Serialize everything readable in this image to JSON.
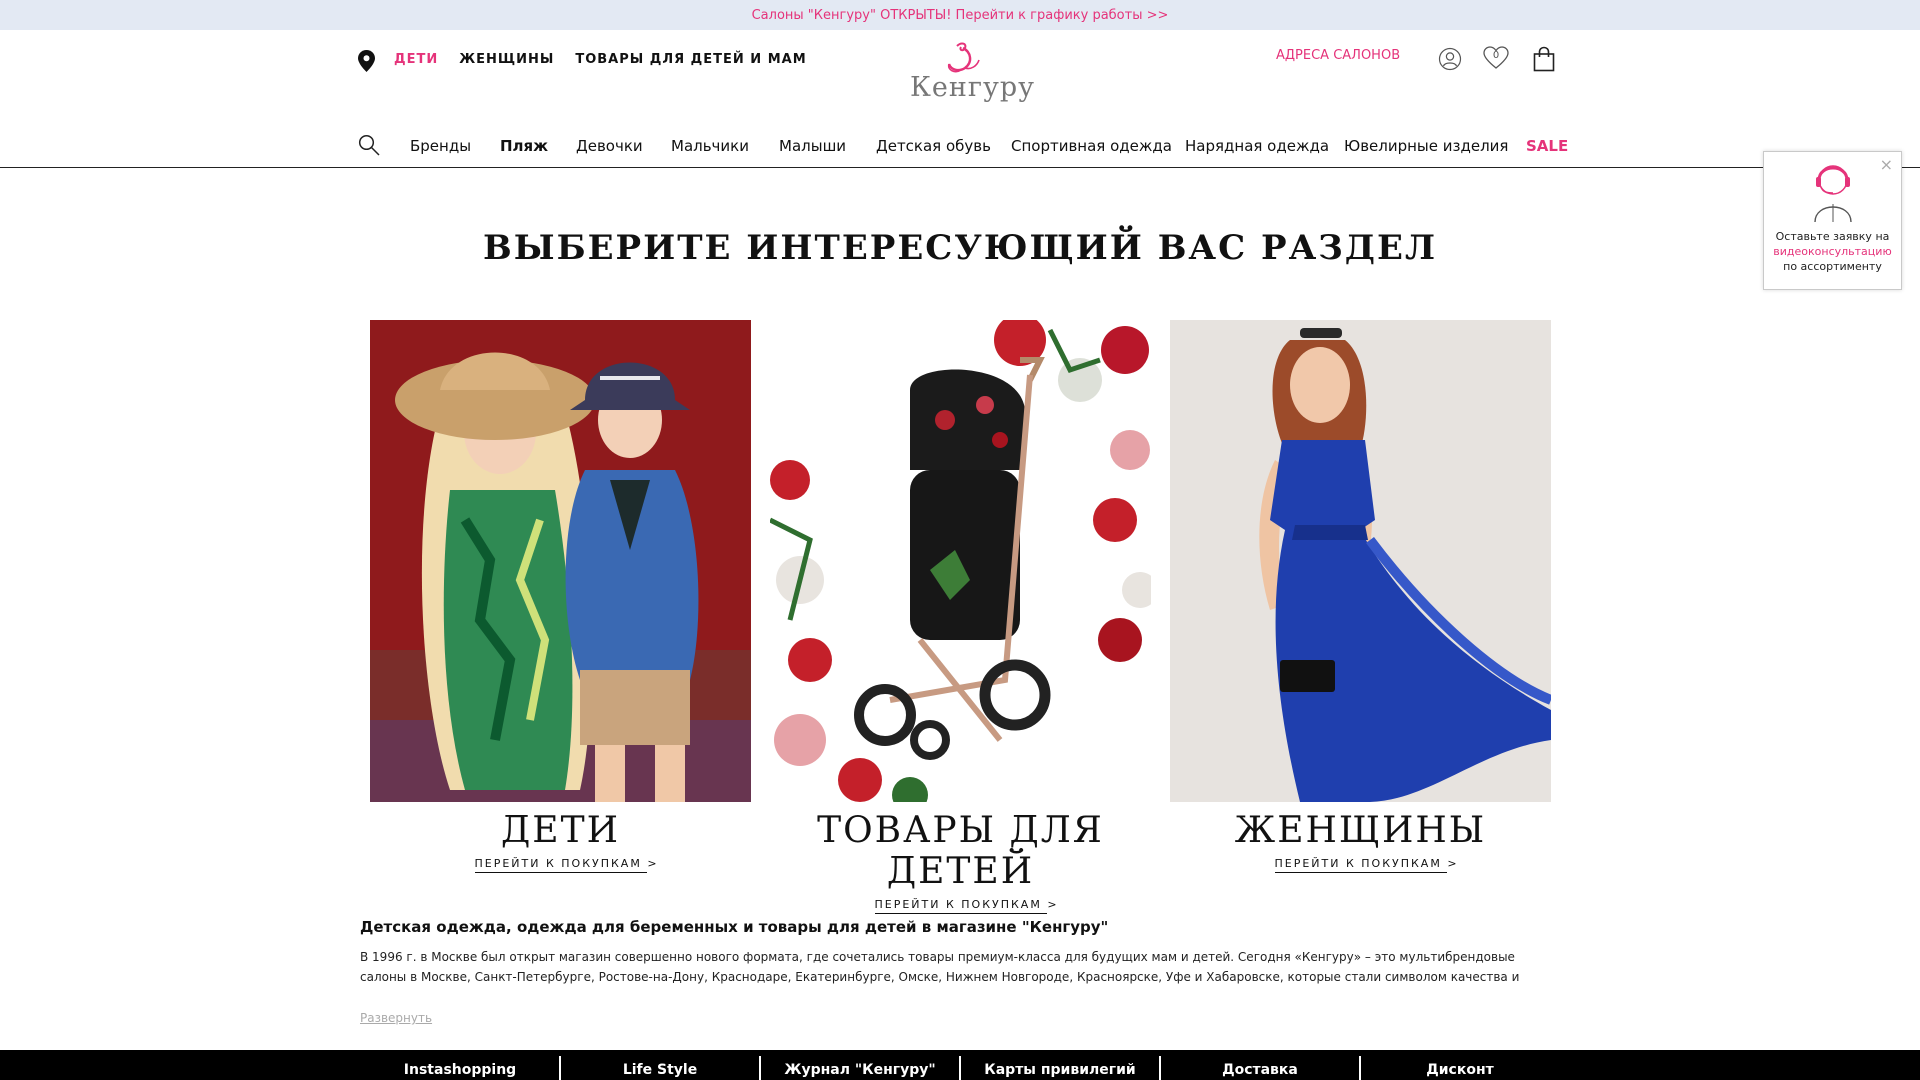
{
  "promo": {
    "text": "Салоны \"Кенгуру\" ОТКРЫТЫ! Перейти к графику работы >>"
  },
  "header": {
    "top_nav": [
      {
        "label": "ДЕТИ",
        "active": true
      },
      {
        "label": "ЖЕНЩИНЫ",
        "active": false
      },
      {
        "label": "ТОВАРЫ ДЛЯ ДЕТЕЙ И МАМ",
        "active": false
      }
    ],
    "logo_text": "Кенгуру",
    "addresses_label": "АДРЕСА САЛОНОВ",
    "favorites_count": "0",
    "icons": [
      "location-pin-icon",
      "user-icon",
      "heart-icon",
      "shopping-bag-icon",
      "search-icon"
    ]
  },
  "catalog_nav": [
    {
      "label": "Бренды",
      "style": "normal"
    },
    {
      "label": "Пляж",
      "style": "bold"
    },
    {
      "label": "Девочки",
      "style": "normal"
    },
    {
      "label": "Мальчики",
      "style": "normal"
    },
    {
      "label": "Малыши",
      "style": "normal"
    },
    {
      "label": "Детская обувь",
      "style": "normal"
    },
    {
      "label": "Спортивная одежда",
      "style": "normal"
    },
    {
      "label": "Нарядная одежда",
      "style": "normal"
    },
    {
      "label": "Ювелирные изделия",
      "style": "normal"
    },
    {
      "label": "SALE",
      "style": "sale"
    }
  ],
  "main": {
    "heading": "ВЫБЕРИТЕ ИНТЕРЕСУЮЩИЙ ВАС РАЗДЕЛ",
    "cards": [
      {
        "title": "ДЕТИ",
        "link": "ПЕРЕЙТИ К ПОКУПКАМ  >"
      },
      {
        "title": "ТОВАРЫ ДЛЯ ДЕТЕЙ",
        "link": "ПЕРЕЙТИ К ПОКУПКАМ  >"
      },
      {
        "title": "ЖЕНЩИНЫ",
        "link": "ПЕРЕЙТИ К ПОКУПКАМ  >"
      }
    ]
  },
  "seo": {
    "title": "Детская одежда, одежда для беременных и товары для детей в магазине \"Кенгуру\"",
    "text": "В 1996 г. в Москве был открыт магазин совершенно нового формата, где сочетались товары премиум-класса для будущих мам и детей. Сегодня «Кенгуру» – это мультибрендовые салоны в Москве, Санкт-Петербурге, Ростове-на-Дону, Краснодаре, Екатеринбурге, Омске, Нижнем Новгороде, Красноярске, Уфе и Хабаровске, которые стали символом качества и престижа в области материнства и",
    "expand_label": "Развернуть"
  },
  "consult_widget": {
    "close": "×",
    "line1": "Оставьте заявку на",
    "line2": "видеоконсультацию",
    "line3": "по ассортименту"
  },
  "footer": {
    "items": [
      "Instashopping",
      "Life Style",
      "Журнал \"Кенгуру\"",
      "Карты привилегий",
      "Доставка",
      "Дисконт"
    ]
  },
  "colors": {
    "accent": "#e5337a",
    "promo_bg": "#e3e9f3",
    "footer_bg": "#000000"
  }
}
